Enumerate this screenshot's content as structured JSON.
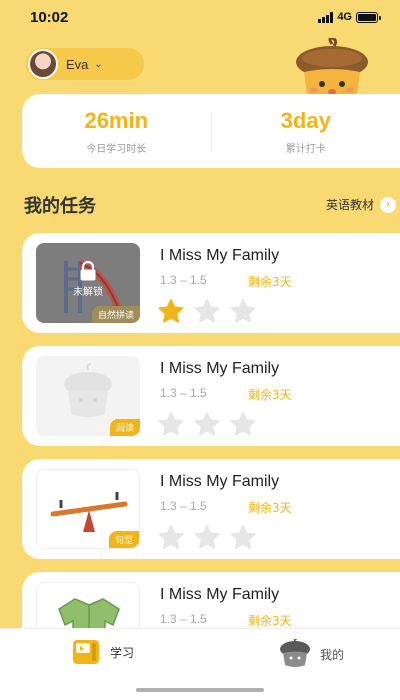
{
  "status_bar": {
    "time": "10:02",
    "network": "4G"
  },
  "user": {
    "name": "Eva"
  },
  "stats": [
    {
      "value": "26min",
      "label": "今日学习时长"
    },
    {
      "value": "3day",
      "label": "累计打卡"
    }
  ],
  "section": {
    "title": "我的任务",
    "link_label": "英语教材"
  },
  "tasks": [
    {
      "title": "I Miss My Family",
      "range": "1.3 – 1.5",
      "remain": "剩余3天",
      "tag": "自然拼读",
      "locked": true,
      "lock_label": "未解锁",
      "stars_earned": 1,
      "stars_total": 3,
      "thumb_icon": "slide-icon"
    },
    {
      "title": "I Miss My Family",
      "range": "1.3 – 1.5",
      "remain": "剩余3天",
      "tag": "阅读",
      "locked": false,
      "stars_earned": 0,
      "stars_total": 3,
      "thumb_icon": "acorn-mascot-icon"
    },
    {
      "title": "I Miss My Family",
      "range": "1.3 – 1.5",
      "remain": "剩余3天",
      "tag": "句型",
      "locked": false,
      "stars_earned": 0,
      "stars_total": 3,
      "thumb_icon": "seesaw-icon"
    },
    {
      "title": "I Miss My Family",
      "range": "1.3 – 1.5",
      "remain": "剩余3天",
      "tag": "",
      "locked": false,
      "stars_earned": 0,
      "stars_total": 3,
      "thumb_icon": "jacket-icon"
    }
  ],
  "tabs": [
    {
      "label": "学习",
      "icon": "book-icon",
      "active": true
    },
    {
      "label": "我的",
      "icon": "acorn-profile-icon",
      "active": false
    }
  ],
  "colors": {
    "background": "#f9d972",
    "accent": "#f2b519",
    "card": "#ffffff",
    "star_inactive": "#e6e6e6"
  }
}
